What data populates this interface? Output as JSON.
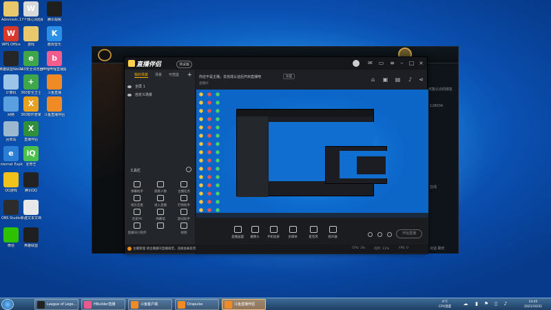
{
  "desktop_icons": [
    {
      "label": "Administr...",
      "color": "#e8c86a",
      "glyph": ""
    },
    {
      "label": "17个核心风险编制模板",
      "color": "#d9d9d9",
      "glyph": "W"
    },
    {
      "label": "腾讯视频",
      "color": "#1f1f1f",
      "glyph": ""
    },
    {
      "label": "WPS Office",
      "color": "#d8392b",
      "glyph": "W"
    },
    {
      "label": "游戏",
      "color": "#e8c86a",
      "glyph": ""
    },
    {
      "label": "酷狗音乐",
      "color": "#2b8fe8",
      "glyph": "K"
    },
    {
      "label": "英雄联盟WeGame版",
      "color": "#262626",
      "glyph": ""
    },
    {
      "label": "360安全浏览器",
      "color": "#3fa64a",
      "glyph": "e"
    },
    {
      "label": "哔哩哔哩直播姬",
      "color": "#f25d8e",
      "glyph": "b"
    },
    {
      "label": "计算机",
      "color": "#9bc4e8",
      "glyph": ""
    },
    {
      "label": "360安全卫士",
      "color": "#3fa64a",
      "glyph": "+"
    },
    {
      "label": "斗鱼直播",
      "color": "#f08a24",
      "glyph": ""
    },
    {
      "label": "网络",
      "color": "#5aa0e0",
      "glyph": ""
    },
    {
      "label": "360软件管家",
      "color": "#e8a020",
      "glyph": "X"
    },
    {
      "label": "斗鱼直播伴侣",
      "color": "#f08a24",
      "glyph": ""
    },
    {
      "label": "回收站",
      "color": "#9cb8d0",
      "glyph": ""
    },
    {
      "label": "直播伴侣",
      "color": "#2f8f3a",
      "glyph": "X"
    },
    {
      "label": "",
      "color": "#fff",
      "glyph": ""
    },
    {
      "label": "Internet Explorer",
      "color": "#2a7fd4",
      "glyph": "e"
    },
    {
      "label": "爱奇艺",
      "color": "#4cc04c",
      "glyph": "iQ"
    },
    {
      "label": "",
      "color": "#fff",
      "glyph": ""
    },
    {
      "label": "QQ游戏",
      "color": "#f2c21c",
      "glyph": ""
    },
    {
      "label": "腾讯QQ",
      "color": "#222",
      "glyph": ""
    },
    {
      "label": "",
      "color": "#fff",
      "glyph": ""
    },
    {
      "label": "OBS Studio",
      "color": "#2c2c2c",
      "glyph": ""
    },
    {
      "label": "新建文本文档",
      "color": "#e8e8e8",
      "glyph": ""
    },
    {
      "label": "",
      "color": "#fff",
      "glyph": ""
    },
    {
      "label": "微信",
      "color": "#2dc100",
      "glyph": ""
    },
    {
      "label": "英雄联盟",
      "color": "#1f1f1f",
      "glyph": ""
    }
  ],
  "game_window": {
    "title": "",
    "right_rows": [
      "可能认识的朋友",
      "好友 (1/1)",
      "请求",
      "128034",
      "在线",
      "全部",
      "游戏中"
    ],
    "bottom_right": "对话 聊天"
  },
  "app": {
    "title": "直播伴侣",
    "badge": "测试版",
    "tabs": [
      "我的场景",
      "场景",
      "可借鉴"
    ],
    "add_tab": "+",
    "scenes": [
      "全屏 1",
      "自定义场景"
    ],
    "tools_title": "工具栏",
    "tools": [
      "弹幕助手",
      "观看人数",
      "主播任务",
      "组队连麦",
      "进入直播",
      "打榜助手",
      "连麦PK",
      "弹幕墙",
      "歌词助手",
      "直播间小程序",
      "",
      "视频"
    ],
    "notice": "你还不是主播，去完成认证后开启直播吧",
    "notice_button": "认证",
    "subtitle": "直播间",
    "controls": [
      "直播画面",
      "摄像头",
      "手机投屏",
      "多媒体",
      "麦克风",
      "扬声器"
    ],
    "start_button": "开始直播",
    "status_msg": "主播管理 请主播遵守直播规范，违规会被处罚",
    "status_right": [
      "CPU: 3%",
      "内存: 11%",
      "FPS: 0"
    ]
  },
  "taskbar": {
    "items": [
      {
        "label": "League of Lege...",
        "color": "#222",
        "active": false
      },
      {
        "label": "HBuilder直播",
        "color": "#e85a8c",
        "active": false
      },
      {
        "label": "斗鱼客户端",
        "color": "#f08a24",
        "active": false
      },
      {
        "label": "Drapulse",
        "color": "#f08a24",
        "active": false
      },
      {
        "label": "斗鱼直播伴侣",
        "color": "#f08a24",
        "active": true
      }
    ],
    "weather_temp": "4°C",
    "weather_label": "CPU温度",
    "time": "14:45",
    "date": "2021/10/31"
  }
}
